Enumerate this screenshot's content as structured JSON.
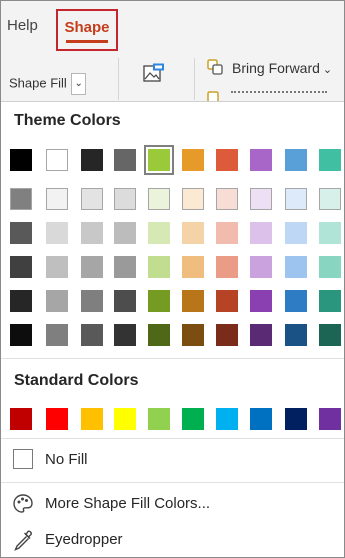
{
  "tabs": {
    "help": "Help",
    "shape": "Shape"
  },
  "ribbon": {
    "shape_fill": "Shape Fill",
    "shape_fill_chevron": "⌄",
    "bring_forward": "Bring Forward",
    "bring_forward_chevron": "⌄",
    "image_icon": "picture-icon",
    "bring_forward_icon": "bring-forward-icon"
  },
  "panel": {
    "theme_title": "Theme Colors",
    "standard_title": "Standard Colors",
    "theme_colors": [
      [
        "#000000",
        "#ffffff",
        "#262626",
        "#666666",
        "#9ac93a",
        "#e69a2a",
        "#dd5a3b",
        "#a866c9",
        "#5aa0d8",
        "#40bfa2"
      ],
      [
        "#808080",
        "#f2f2f2",
        "#e3e3e3",
        "#dcdcdc",
        "#ebf4da",
        "#fbe9d4",
        "#f8ddd6",
        "#ede0f4",
        "#dceafa",
        "#d7f1ea"
      ],
      [
        "#595959",
        "#d9d9d9",
        "#c8c8c8",
        "#bcbcbc",
        "#d6e9b5",
        "#f5d3a8",
        "#f1bcae",
        "#dcc2ea",
        "#bdd7f5",
        "#b0e4d6"
      ],
      [
        "#404040",
        "#bfbfbf",
        "#a6a6a6",
        "#9a9a9a",
        "#c1dd90",
        "#efbe7f",
        "#eb9c86",
        "#caa3de",
        "#9cc4ef",
        "#88d5c1"
      ],
      [
        "#262626",
        "#a6a6a6",
        "#7f7f7f",
        "#4d4d4d",
        "#759b22",
        "#b8751a",
        "#b64325",
        "#8a40b0",
        "#2e7cc4",
        "#2a967d"
      ],
      [
        "#0d0d0d",
        "#7f7f7f",
        "#595959",
        "#333333",
        "#4e6817",
        "#7b4d10",
        "#7a2b19",
        "#5a2a75",
        "#1b5285",
        "#1c6453"
      ]
    ],
    "standard_colors": [
      "#c00000",
      "#ff0000",
      "#ffc000",
      "#ffff00",
      "#92d050",
      "#00b050",
      "#00b0f0",
      "#0070c0",
      "#002060",
      "#7030a0"
    ],
    "selected_color": "#9ac93a",
    "no_fill": "No Fill",
    "more_colors": "More Shape Fill Colors...",
    "eyedropper": "Eyedropper",
    "palette_icon": "palette-icon",
    "eyedropper_icon": "eyedropper-icon"
  }
}
